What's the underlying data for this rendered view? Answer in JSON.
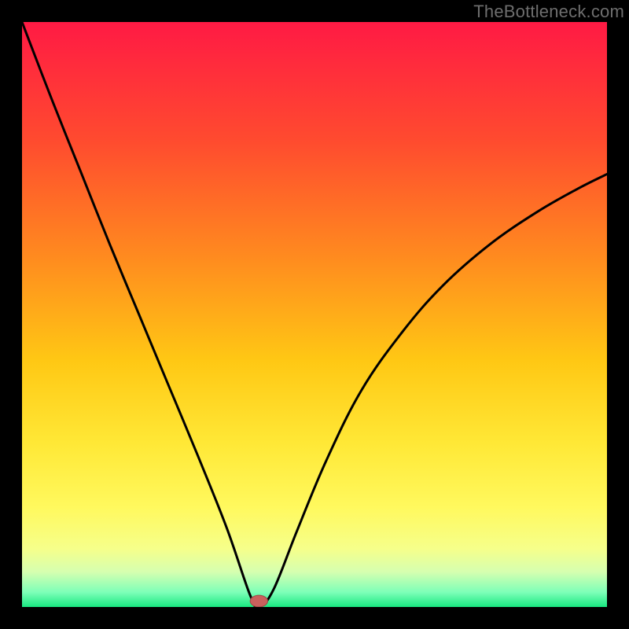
{
  "watermark": "TheBottleneck.com",
  "colors": {
    "frame": "#000000",
    "gradient_stops": [
      {
        "offset": 0.0,
        "color": "#ff1a44"
      },
      {
        "offset": 0.2,
        "color": "#ff4a2f"
      },
      {
        "offset": 0.4,
        "color": "#ff8a1f"
      },
      {
        "offset": 0.58,
        "color": "#ffc814"
      },
      {
        "offset": 0.72,
        "color": "#ffe836"
      },
      {
        "offset": 0.83,
        "color": "#fff95e"
      },
      {
        "offset": 0.9,
        "color": "#f6ff8a"
      },
      {
        "offset": 0.94,
        "color": "#d6ffb0"
      },
      {
        "offset": 0.975,
        "color": "#7dffb8"
      },
      {
        "offset": 1.0,
        "color": "#18e880"
      }
    ],
    "curve": "#000000",
    "marker_fill": "#c9615d",
    "marker_stroke": "#9a4a46"
  },
  "chart_data": {
    "type": "line",
    "title": "",
    "xlabel": "",
    "ylabel": "",
    "xlim": [
      0,
      1
    ],
    "ylim": [
      0,
      1
    ],
    "grid": false,
    "legend": false,
    "note": "Axes are unlabeled; values are normalized fractions of the plot area read from the image. The curve is a V-shaped profile with its minimum near x≈0.40, the right branch rising asymptotically toward y≈0.74.",
    "series": [
      {
        "name": "curve",
        "x": [
          0.0,
          0.05,
          0.1,
          0.15,
          0.2,
          0.25,
          0.3,
          0.35,
          0.39,
          0.405,
          0.43,
          0.47,
          0.52,
          0.58,
          0.65,
          0.72,
          0.8,
          0.88,
          0.95,
          1.0
        ],
        "y": [
          1.0,
          0.87,
          0.745,
          0.62,
          0.5,
          0.38,
          0.26,
          0.135,
          0.02,
          0.0,
          0.03,
          0.13,
          0.25,
          0.37,
          0.47,
          0.55,
          0.62,
          0.675,
          0.715,
          0.74
        ]
      }
    ],
    "marker": {
      "x": 0.405,
      "y": 0.01,
      "rx": 0.015,
      "ry": 0.01
    }
  }
}
